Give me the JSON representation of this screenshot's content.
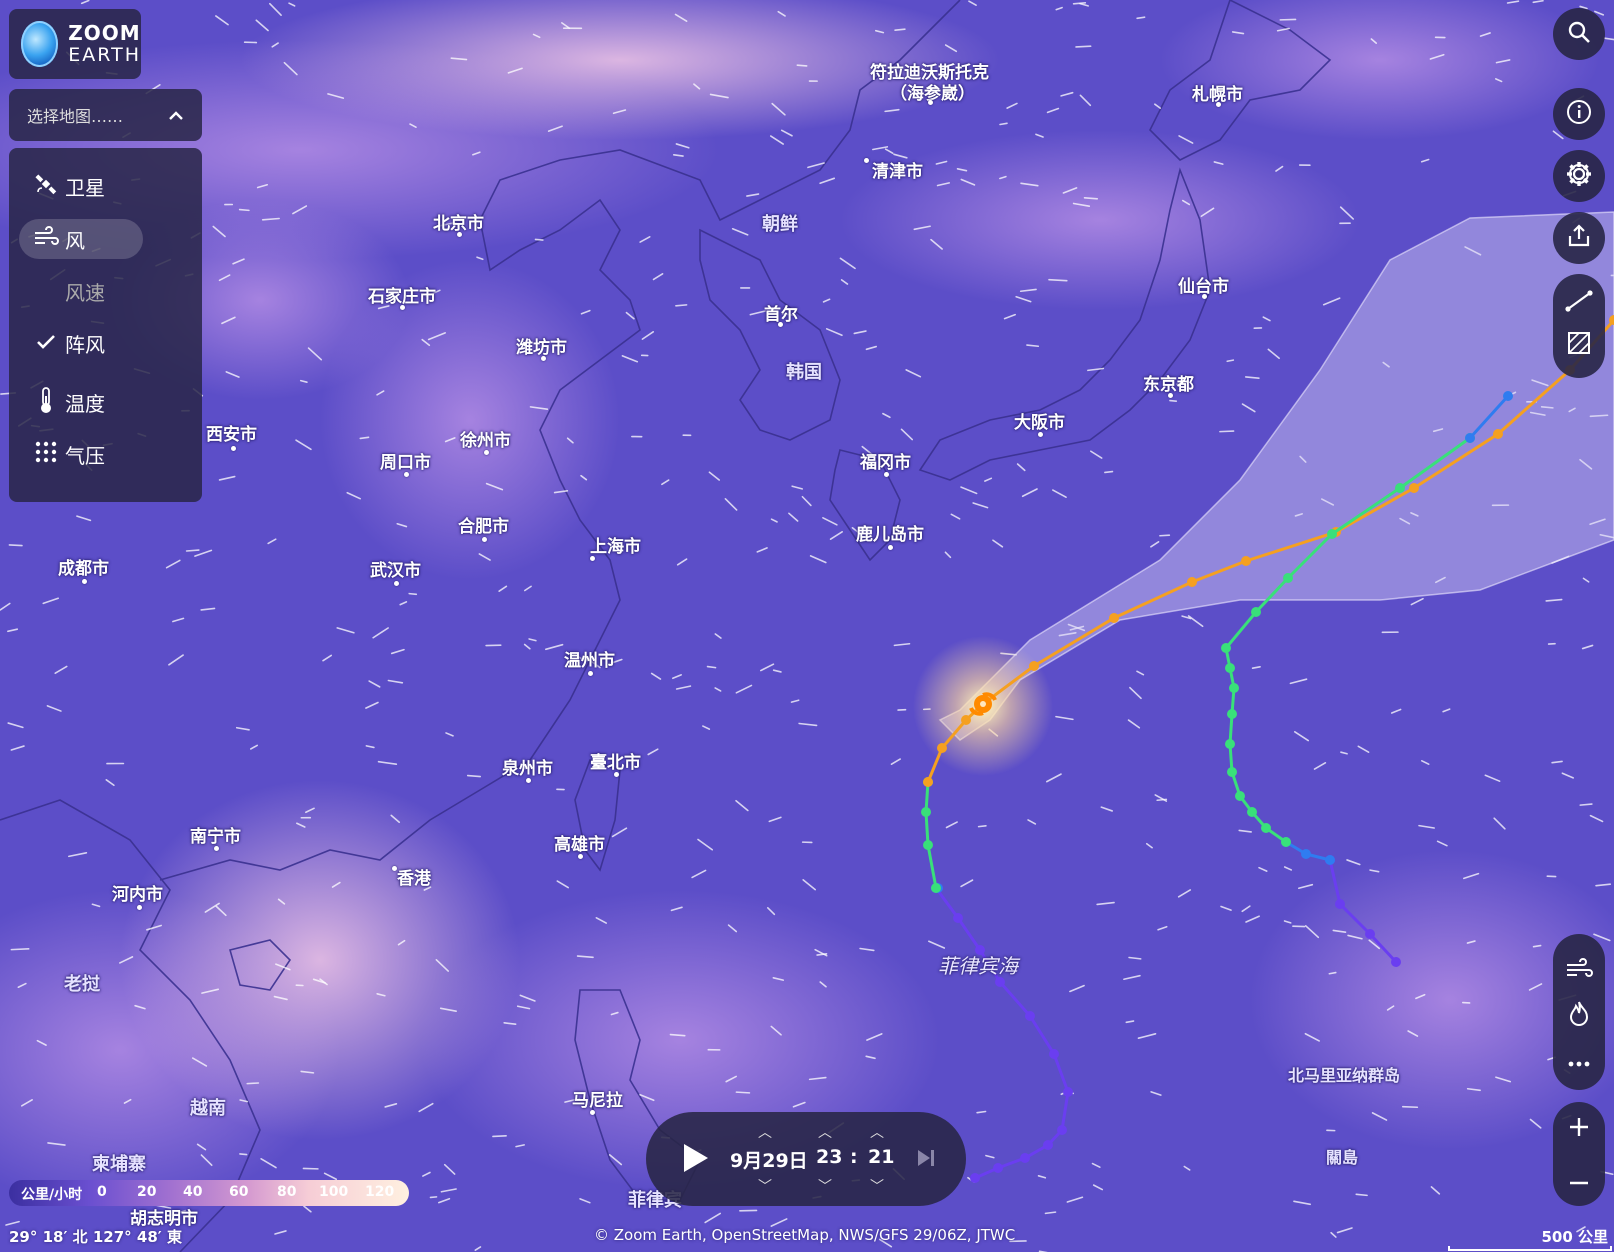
{
  "app": {
    "logo_line1": "ZOOM",
    "logo_line2": "EARTH"
  },
  "map_select": {
    "label": "选择地图……"
  },
  "layers": [
    {
      "label": "卫星",
      "icon": "satellite-icon"
    },
    {
      "label": "风",
      "icon": "wind-icon",
      "selected": true
    },
    {
      "label": "风速",
      "icon": ""
    },
    {
      "label": "阵风",
      "icon": "check-icon"
    },
    {
      "label": "温度",
      "icon": "thermometer-icon"
    },
    {
      "label": "气压",
      "icon": "pressure-dots-icon"
    }
  ],
  "places": {
    "vladivostok": "符拉迪沃斯托克",
    "vladivostok2": "（海参崴）",
    "sapporo": "札幌市",
    "chongjin": "清津市",
    "beijing": "北京市",
    "dprk": "朝鲜",
    "shijiazhuang": "石家庄市",
    "weifang": "潍坊市",
    "seoul": "首尔",
    "sendai": "仙台市",
    "rok": "韩国",
    "tokyo": "东京都",
    "osaka": "大阪市",
    "xian": "西安市",
    "xuzhou": "徐州市",
    "zhoukou": "周口市",
    "fukuoka": "福冈市",
    "hefei": "合肥市",
    "kagoshima": "鹿儿岛市",
    "shanghai": "上海市",
    "chengdu": "成都市",
    "wuhan": "武汉市",
    "wenzhou": "温州市",
    "quanzhou": "泉州市",
    "taipei": "臺北市",
    "nanning": "南宁市",
    "kaohsiung": "高雄市",
    "hongkong": "香港",
    "hanoi": "河内市",
    "philippine_sea": "菲律宾海",
    "laos": "老挝",
    "vietnam": "越南",
    "manila": "马尼拉",
    "cambodia": "柬埔寨",
    "hcmc": "胡志明市",
    "philippines": "菲律宾",
    "n_mariana": "北马里亚纳群岛",
    "guam": "關島"
  },
  "legend": {
    "unit": "公里/小时",
    "ticks": [
      "0",
      "20",
      "40",
      "60",
      "80",
      "100",
      "120"
    ]
  },
  "coords": "29° 18′ 北   127° 48′ 東",
  "attribution": "© Zoom Earth, OpenStreetMap, NWS/GFS 29/06Z, JTWC",
  "scale": "500 公里",
  "time": {
    "date": "9月29日",
    "hour": "23",
    "sep": ":",
    "minute": "21"
  },
  "colors": {
    "track_orange": "#f5a020",
    "track_green": "#39e07a",
    "track_blue": "#2f7cf0",
    "track_purple": "#6a3ef0",
    "storm": "#ff8a00"
  }
}
